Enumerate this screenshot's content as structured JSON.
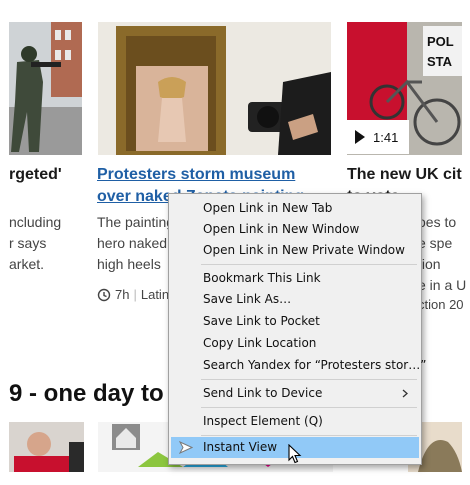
{
  "articles": [
    {
      "headline": "rgeted'",
      "summary_lines": [
        "ncluding",
        "r says",
        "arket."
      ]
    },
    {
      "headline_lines": [
        "Protesters storm museum",
        "over naked Zapata painting"
      ],
      "summary_lines": [
        "The painting",
        "hero naked",
        "high heels"
      ],
      "age": "7h",
      "section": "Latin"
    },
    {
      "headline_lines": [
        "The new UK cit",
        "to vote"
      ],
      "summary_lines": [
        "oes to",
        "e spe",
        "tion",
        "e in a U"
      ],
      "video_duration": "1:41",
      "section": "ction 20"
    }
  ],
  "section_heading": "9 - one day to g",
  "context_menu": {
    "items": [
      {
        "label": "Open Link in New Tab"
      },
      {
        "label": "Open Link in New Window"
      },
      {
        "label": "Open Link in New Private Window"
      },
      {
        "label": "Bookmark This Link"
      },
      {
        "label": "Save Link As…"
      },
      {
        "label": "Save Link to Pocket"
      },
      {
        "label": "Copy Link Location"
      },
      {
        "label": "Search Yandex for “Protesters stor…”"
      },
      {
        "label": "Send Link to Device"
      },
      {
        "label": "Inspect Element (Q)"
      },
      {
        "label": "Instant View"
      }
    ],
    "highlighted": "Instant View"
  },
  "icons": {
    "clock": "clock-icon",
    "play": "play-icon",
    "submenu": "chevron-right-icon",
    "instant_view": "instant-view-icon",
    "cursor": "mouse-pointer-icon",
    "home": "home-icon"
  },
  "colors": {
    "link": "#1f5fa5",
    "menu_background": "#f0f0f0",
    "menu_highlight": "#91c9f7",
    "poster_red": "#c8102e"
  }
}
